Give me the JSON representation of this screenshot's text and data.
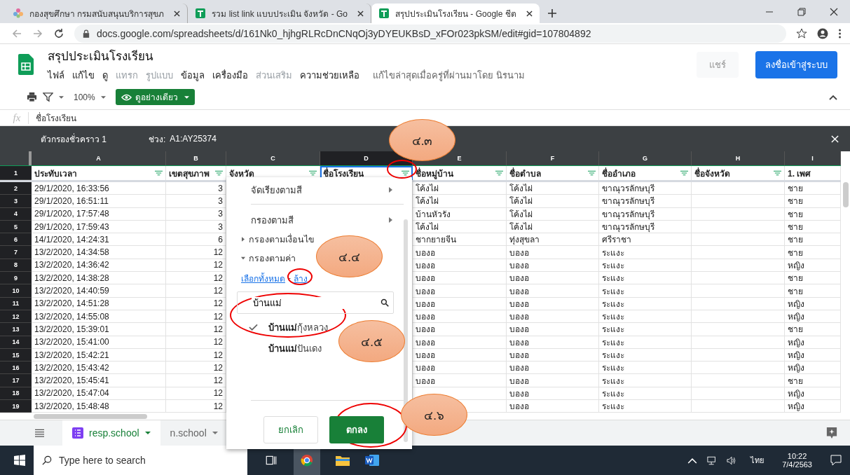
{
  "browser": {
    "tabs": [
      {
        "title": "กองสุขศึกษา กรมสนับสนุนบริการสุขภ",
        "selected": false
      },
      {
        "title": "รวม list link แบบประเมิน จังหวัด - Go",
        "selected": false
      },
      {
        "title": "สรุปประเมินโรงเรียน - Google ชีต",
        "selected": true
      }
    ],
    "address": "docs.google.com/spreadsheets/d/161Nk0_hjhgRLRcDnCNqOj3yDYEUKBsD_xFOr023pkSM/edit#gid=107804892"
  },
  "app": {
    "title": "สรุปประเมินโรงเรียน",
    "menus": [
      {
        "label": "ไฟล์",
        "disabled": false
      },
      {
        "label": "แก้ไข",
        "disabled": false
      },
      {
        "label": "ดู",
        "disabled": false
      },
      {
        "label": "แทรก",
        "disabled": true
      },
      {
        "label": "รูปแบบ",
        "disabled": true
      },
      {
        "label": "ข้อมูล",
        "disabled": false
      },
      {
        "label": "เครื่องมือ",
        "disabled": false
      },
      {
        "label": "ส่วนเสริม",
        "disabled": true
      },
      {
        "label": "ความช่วยเหลือ",
        "disabled": false
      }
    ],
    "last_edit": "แก้ไขล่าสุดเมื่อครู่ที่ผ่านมาโดย นิรนาม",
    "share_button": {
      "label": "แชร์",
      "disabled": true
    },
    "sign_in_button": "ลงชื่อเข้าสู่ระบบ"
  },
  "toolbar": {
    "zoom": "100%",
    "mode_button": "ดูอย่างเดียว"
  },
  "formula_bar": {
    "fx": "fx",
    "value": "ชื่อโรงเรียน"
  },
  "filter_bar": {
    "name": "ตัวกรองชั่วคราว 1",
    "range_label": "ช่วง:",
    "range": "A1:AY25374"
  },
  "sheet": {
    "columns": [
      {
        "letter": "A",
        "header": "ประทับเวลา",
        "filter": true,
        "selected": false
      },
      {
        "letter": "B",
        "header": "เขตสุขภาพ",
        "filter": true,
        "selected": false
      },
      {
        "letter": "C",
        "header": "จังหวัด",
        "filter": true,
        "selected": false
      },
      {
        "letter": "D",
        "header": "ชื่อโรงเรียน",
        "filter": true,
        "selected": true
      },
      {
        "letter": "E",
        "header": "ชื่อหมู่บ้าน",
        "filter": true,
        "selected": false
      },
      {
        "letter": "F",
        "header": "ชื่อตำบล",
        "filter": true,
        "selected": false
      },
      {
        "letter": "G",
        "header": "ชื่ออำเภอ",
        "filter": true,
        "selected": false
      },
      {
        "letter": "H",
        "header": "ชื่อจังหวัด",
        "filter": true,
        "selected": false
      },
      {
        "letter": "I",
        "header": "1. เพศ",
        "filter": false,
        "selected": false
      }
    ],
    "header_row_number": "1",
    "rows": [
      {
        "num": "2",
        "timestamp": "29/1/2020, 16:33:56",
        "zone": "3",
        "village": "โค้งไผ่",
        "subdistrict": "โค้งไผ่",
        "district": "ขาณุวรลักษบุรี",
        "sex": "ชาย"
      },
      {
        "num": "3",
        "timestamp": "29/1/2020, 16:51:11",
        "zone": "3",
        "village": "โค้งไผ่",
        "subdistrict": "โค้งไผ่",
        "district": "ขาณุวรลักษบุรี",
        "sex": "ชาย"
      },
      {
        "num": "4",
        "timestamp": "29/1/2020, 17:57:48",
        "zone": "3",
        "village": "บ้านหัวรัง",
        "subdistrict": "โค้งไผ่",
        "district": "ขาณุวรลักษบุรี",
        "sex": "ชาย"
      },
      {
        "num": "5",
        "timestamp": "29/1/2020, 17:59:43",
        "zone": "3",
        "village": "โค้งไผ่",
        "subdistrict": "โค้งไผ่",
        "district": "ขาณุวรลักษบุรี",
        "sex": "ชาย"
      },
      {
        "num": "6",
        "timestamp": "14/1/2020, 14:24:31",
        "zone": "6",
        "village": "ชากยายจีน",
        "subdistrict": "ทุ่งสุขลา",
        "district": "ศรีราชา",
        "sex": "ชาย"
      },
      {
        "num": "7",
        "timestamp": "13/2/2020, 14:34:58",
        "zone": "12",
        "village": "บองอ",
        "subdistrict": "บองอ",
        "district": "ระแงะ",
        "sex": "ชาย"
      },
      {
        "num": "8",
        "timestamp": "13/2/2020, 14:36:42",
        "zone": "12",
        "village": "บองอ",
        "subdistrict": "บองอ",
        "district": "ระแงะ",
        "sex": "หญิง"
      },
      {
        "num": "9",
        "timestamp": "13/2/2020, 14:38:28",
        "zone": "12",
        "village": "บองอ",
        "subdistrict": "บองอ",
        "district": "ระแงะ",
        "sex": "ชาย"
      },
      {
        "num": "10",
        "timestamp": "13/2/2020, 14:40:59",
        "zone": "12",
        "village": "บองอ",
        "subdistrict": "บองอ",
        "district": "ระแงะ",
        "sex": "ชาย"
      },
      {
        "num": "11",
        "timestamp": "13/2/2020, 14:51:28",
        "zone": "12",
        "village": "บองอ",
        "subdistrict": "บองอ",
        "district": "ระแงะ",
        "sex": "หญิง"
      },
      {
        "num": "12",
        "timestamp": "13/2/2020, 14:55:08",
        "zone": "12",
        "village": "บองอ",
        "subdistrict": "บองอ",
        "district": "ระแงะ",
        "sex": "หญิง"
      },
      {
        "num": "13",
        "timestamp": "13/2/2020, 15:39:01",
        "zone": "12",
        "village": "บองอ",
        "subdistrict": "บองอ",
        "district": "ระแงะ",
        "sex": "ชาย"
      },
      {
        "num": "14",
        "timestamp": "13/2/2020, 15:41:00",
        "zone": "12",
        "village": "บองอ",
        "subdistrict": "บองอ",
        "district": "ระแงะ",
        "sex": "หญิง"
      },
      {
        "num": "15",
        "timestamp": "13/2/2020, 15:42:21",
        "zone": "12",
        "village": "บองอ",
        "subdistrict": "บองอ",
        "district": "ระแงะ",
        "sex": "หญิง"
      },
      {
        "num": "16",
        "timestamp": "13/2/2020, 15:43:42",
        "zone": "12",
        "village": "บองอ",
        "subdistrict": "บองอ",
        "district": "ระแงะ",
        "sex": "หญิง"
      },
      {
        "num": "17",
        "timestamp": "13/2/2020, 15:45:41",
        "zone": "12",
        "village": "บองอ",
        "subdistrict": "บองอ",
        "district": "ระแงะ",
        "sex": "ชาย"
      },
      {
        "num": "18",
        "timestamp": "13/2/2020, 15:47:04",
        "zone": "12",
        "subdistrict": "บองอ",
        "district": "ระแงะ",
        "sex": "หญิง"
      },
      {
        "num": "19",
        "timestamp": "13/2/2020, 15:48:48",
        "zone": "12",
        "subdistrict": "บองอ",
        "district": "ระแงะ",
        "sex": "หญิง"
      }
    ]
  },
  "filter_menu": {
    "sort_by_color": "จัดเรียงตามสี",
    "filter_by_color": "กรองตามสี",
    "sections": [
      {
        "label": "กรองตามเงื่อนไข",
        "expanded": false
      },
      {
        "label": "กรองตามค่า",
        "expanded": true
      }
    ],
    "select_all": "เลือกทั้งหมด",
    "link_separator": "-",
    "clear": "ล้าง",
    "search": {
      "value": "บ้านแม่"
    },
    "values": [
      {
        "label": "**บ้านแม่**กุ้งหลวง",
        "checked": true
      },
      {
        "label": "**บ้านแม่**ปันเดง",
        "checked": false
      }
    ],
    "cancel": "ยกเลิก",
    "ok": "ตกลง"
  },
  "sheet_tabs": [
    {
      "label": "resp.school",
      "selected": true
    },
    {
      "label": "n.school",
      "selected": false
    }
  ],
  "taskbar": {
    "search_placeholder": "Type here to search",
    "language": "ไทย",
    "time": "10:22",
    "date": "7/4/2563"
  },
  "callouts": [
    {
      "text": "๔.๓"
    },
    {
      "text": "๔.๔"
    },
    {
      "text": "๔.๕"
    },
    {
      "text": "๔.๖"
    }
  ]
}
